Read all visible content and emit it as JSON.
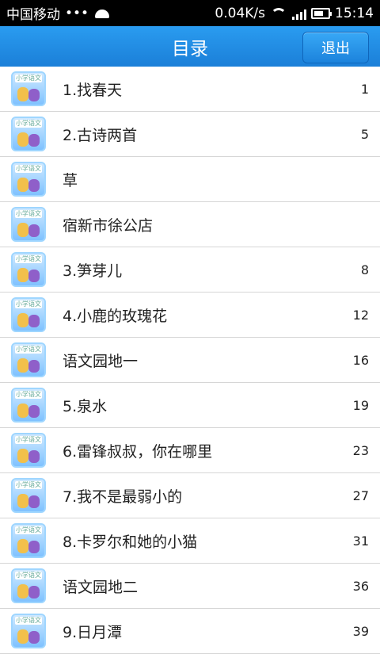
{
  "status_bar": {
    "carrier": "中国移动",
    "dots": "•••",
    "net_speed": "0.04K/s",
    "time": "15:14"
  },
  "header": {
    "title": "目录",
    "exit_label": "退出"
  },
  "thumbnail": {
    "cover_text": "小学语文"
  },
  "items": [
    {
      "title": "1.找春天",
      "page": "1"
    },
    {
      "title": "2.古诗两首",
      "page": "5"
    },
    {
      "title": "草",
      "page": ""
    },
    {
      "title": "宿新市徐公店",
      "page": ""
    },
    {
      "title": "3.笋芽儿",
      "page": "8"
    },
    {
      "title": "4.小鹿的玫瑰花",
      "page": "12"
    },
    {
      "title": "语文园地一",
      "page": "16"
    },
    {
      "title": "5.泉水",
      "page": "19"
    },
    {
      "title": "6.雷锋叔叔，你在哪里",
      "page": "23"
    },
    {
      "title": "7.我不是最弱小的",
      "page": "27"
    },
    {
      "title": "8.卡罗尔和她的小猫",
      "page": "31"
    },
    {
      "title": "语文园地二",
      "page": "36"
    },
    {
      "title": "9.日月潭",
      "page": "39"
    }
  ]
}
